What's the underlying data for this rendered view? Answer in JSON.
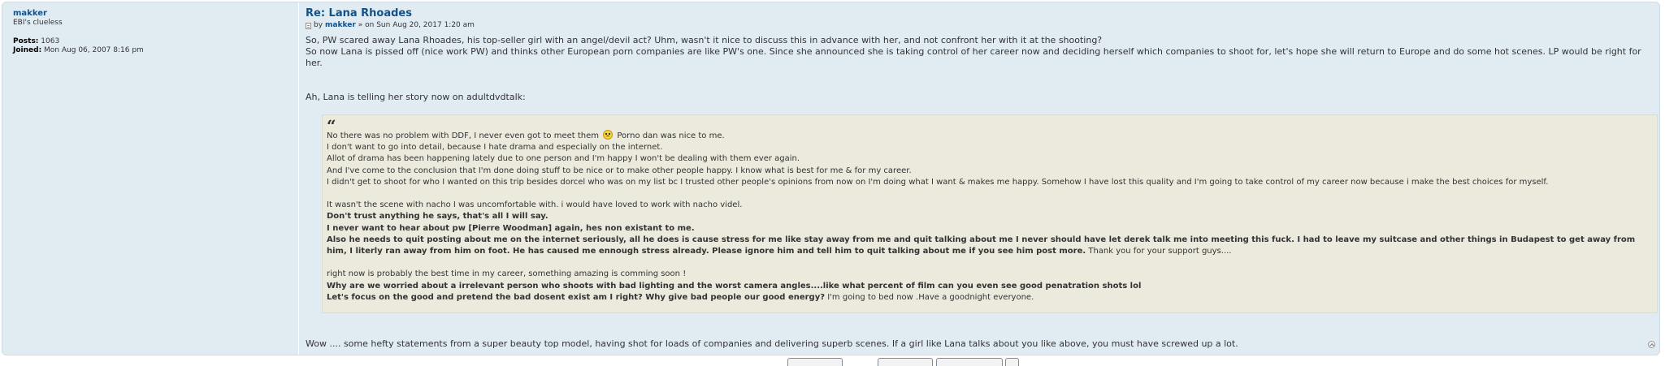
{
  "profile": {
    "username": "makker",
    "rank": "EBI's clueless",
    "posts_label": "Posts:",
    "posts_value": "1063",
    "joined_label": "Joined:",
    "joined_value": "Mon Aug 06, 2007 8:16 pm"
  },
  "post": {
    "title": "Re: Lana Rhoades",
    "meta_by": "by",
    "author": "makker",
    "date": "» on Sun Aug 20, 2017 1:20 am",
    "para1_line1": "So, PW scared away Lana Rhoades, his top-seller girl with an angel/devil act? Uhm, wasn't it nice to discuss this in advance with her, and not confront her with it at the shooting?",
    "para1_line2": "So now Lana is pissed off (nice work PW) and thinks other European porn companies are like PW's one. Since she announced she is taking control of her career now and deciding herself which companies to shoot for, let's hope she will return to Europe and do some hot scenes. LP would be right for her.",
    "para2": "Ah, Lana is telling her story now on adultdvdtalk:",
    "closing": "Wow .... some hefty statements from a super beauty top model, having shot for loads of companies and delivering superb scenes. If a girl like Lana talks about you like above, you must have screwed up a lot."
  },
  "quote": {
    "mark": "“",
    "l1a": "No there was no problem with DDF, I never even got to meet them",
    "l1b": "Porno dan was nice to me.",
    "l2": "I don't want to go into detail, because I hate drama and especially on the internet.",
    "l3": "Allot of drama has been happening lately due to one person and I'm happy I won't be dealing with them ever again.",
    "l4": "And I've come to the conclusion that I'm done doing stuff to be nice or to make other people happy. I know what is best for me & for my career.",
    "l5": "I didn't get to shoot for who I wanted on this trip besides dorcel who was on my list bc I trusted other people's opinions from now on I'm doing what I want & makes me happy. Somehow I have lost this quality and I'm going to take control of my career now because i make the best choices for myself.",
    "l6": "It wasn't the scene with nacho I was uncomfortable with. i would have loved to work with nacho videl.",
    "l7": "Don't trust anything he says, that's all I will say.",
    "l8": "I never want to hear about pw [Pierre Woodman] again, hes non existant to me.",
    "l9_bold": "Also he needs to quit posting about me on the internet seriously, all he does is cause stress for me like stay away from me and quit talking about me I never should have let derek talk me into meeting this fuck. I had to leave my suitcase and other things in Budapest to get away from him, I literly ran away from him on foot. He has caused me ennough stress already. Please ignore him and tell him to quit talking about me if you see him post more.",
    "l9_normal": " Thank you for your support guys....",
    "l10": "right now is probably the best time in my career, something amazing is comming soon !",
    "l11": "Why are we worried about a irrelevant person who shoots with bad lighting and the worst camera angles....like what percent of film can you even see good penatration shots lol",
    "l12_bold": "Let's focus on the good and pretend the bad dosent exist am I right? Why give bad people our good energy?",
    "l12_normal": " I'm going to bed now .Have a goodnight everyone."
  },
  "icons": {
    "post_icon": "post-icon",
    "smiley": "confused-smiley-icon",
    "back_to_top": "back-to-top-icon"
  },
  "colors": {
    "post_bg": "#e1ebf2",
    "link": "#105289",
    "quote_bg": "#ebeadd"
  }
}
